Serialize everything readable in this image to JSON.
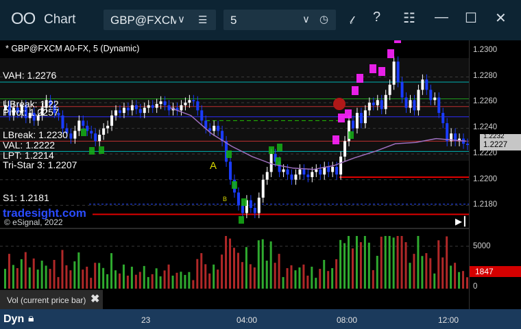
{
  "window": {
    "app_icon": "OO",
    "title": "Chart",
    "symbol": "GBP@FXCM",
    "interval": "5",
    "icons": {
      "symbol_dropdown": "chevron-down-icon",
      "symbol_list": "list-icon",
      "interval_dropdown": "chevron-down-icon",
      "interval_clock": "clock-icon",
      "draw": "pen-icon",
      "help": "help-icon",
      "template": "template-icon",
      "minimize": "minimize-icon",
      "maximize": "maximize-icon",
      "close": "close-icon"
    }
  },
  "chart": {
    "study_title": "* GBP@FXCM A0-FX, 5 (Dynamic)",
    "levels": [
      {
        "label": "VAH: 1.2276",
        "color": "#00c8c8"
      },
      {
        "label": "UBreak: 1.22",
        "color": "#22c400"
      },
      {
        "label": "Pivot: 1.2257",
        "color": "#d83a3a"
      },
      {
        "label": "LBreak: 1.2230",
        "color": "#d83a3a"
      },
      {
        "label": "VAL: 1.2222",
        "color": "#00c8c8"
      },
      {
        "label": "LPT: 1.2214",
        "color": "#ffffff"
      },
      {
        "label": "Tri-Star 3: 1.2207",
        "color": "#ffffff"
      },
      {
        "label": "S1: 1.2181",
        "color": "#2a4cff"
      }
    ],
    "brand": "tradesight.com",
    "copyright": "© eSignal, 2022",
    "marker_A": "A",
    "marker_B": "B",
    "last_price": "1.2227",
    "last_price_prev": "1.2232",
    "y_ticks": [
      "1.2300",
      "1.2280",
      "1.2260",
      "1.2240",
      "1.2220",
      "1.2200",
      "1.2180"
    ],
    "colors": {
      "bull": "#ffffff",
      "bear": "#1a3cff",
      "ma": "#a070c0",
      "magenta": "#ff22ff",
      "green_counter": "#16b016",
      "red_line": "#e00000"
    }
  },
  "volume": {
    "legend": "Vol (current price bar)",
    "close_icon": "close-icon",
    "close_glyph": "✖",
    "y_ticks": [
      "5000",
      "0"
    ],
    "current": "1847"
  },
  "bottom": {
    "mode": "Dyn",
    "lock_icon": "lock-icon",
    "x_ticks": [
      "23",
      "04:00",
      "08:00",
      "12:00"
    ]
  },
  "chart_data": {
    "type": "candlestick",
    "symbol": "GBP@FXCM A0-FX",
    "interval": "5",
    "ylim": [
      1.2165,
      1.2305
    ],
    "x_ticks": [
      "23",
      "04:00",
      "08:00",
      "12:00"
    ],
    "path": [
      [
        0,
        1.2254
      ],
      [
        6,
        1.2258
      ],
      [
        12,
        1.225
      ],
      [
        18,
        1.2256
      ],
      [
        24,
        1.2252
      ],
      [
        30,
        1.2258
      ],
      [
        36,
        1.2248
      ],
      [
        42,
        1.2252
      ],
      [
        48,
        1.2246
      ],
      [
        54,
        1.225
      ],
      [
        60,
        1.2256
      ],
      [
        66,
        1.2262
      ],
      [
        72,
        1.2258
      ],
      [
        78,
        1.2252
      ],
      [
        84,
        1.225
      ],
      [
        90,
        1.224
      ],
      [
        96,
        1.2236
      ],
      [
        102,
        1.2232
      ],
      [
        108,
        1.2238
      ],
      [
        114,
        1.2246
      ],
      [
        120,
        1.2242
      ],
      [
        126,
        1.2238
      ],
      [
        132,
        1.2236
      ],
      [
        138,
        1.223
      ],
      [
        144,
        1.2235
      ],
      [
        150,
        1.224
      ],
      [
        156,
        1.2242
      ],
      [
        162,
        1.225
      ],
      [
        168,
        1.2254
      ],
      [
        174,
        1.2252
      ],
      [
        180,
        1.2256
      ],
      [
        186,
        1.2254
      ],
      [
        192,
        1.2258
      ],
      [
        198,
        1.2255
      ],
      [
        204,
        1.2252
      ],
      [
        210,
        1.2256
      ],
      [
        216,
        1.2258
      ],
      [
        222,
        1.2256
      ],
      [
        228,
        1.2259
      ],
      [
        234,
        1.2261
      ],
      [
        240,
        1.2258
      ],
      [
        246,
        1.2254
      ],
      [
        252,
        1.2256
      ],
      [
        258,
        1.2254
      ],
      [
        264,
        1.2258
      ],
      [
        270,
        1.226
      ],
      [
        276,
        1.2262
      ],
      [
        282,
        1.2261
      ],
      [
        288,
        1.2254
      ],
      [
        294,
        1.2246
      ],
      [
        300,
        1.224
      ],
      [
        306,
        1.2238
      ],
      [
        312,
        1.2242
      ],
      [
        318,
        1.2238
      ],
      [
        324,
        1.223
      ],
      [
        330,
        1.2214
      ],
      [
        336,
        1.22
      ],
      [
        342,
        1.219
      ],
      [
        348,
        1.218
      ],
      [
        354,
        1.2174
      ],
      [
        360,
        1.2184
      ],
      [
        366,
        1.2178
      ],
      [
        372,
        1.2174
      ],
      [
        378,
        1.2186
      ],
      [
        384,
        1.22
      ],
      [
        390,
        1.2206
      ],
      [
        396,
        1.222
      ],
      [
        402,
        1.2214
      ],
      [
        408,
        1.2206
      ],
      [
        414,
        1.2208
      ],
      [
        420,
        1.2204
      ],
      [
        426,
        1.22
      ],
      [
        432,
        1.2204
      ],
      [
        438,
        1.2208
      ],
      [
        444,
        1.2204
      ],
      [
        450,
        1.2202
      ],
      [
        456,
        1.2206
      ],
      [
        462,
        1.2208
      ],
      [
        468,
        1.2204
      ],
      [
        474,
        1.221
      ],
      [
        480,
        1.2206
      ],
      [
        486,
        1.221
      ],
      [
        492,
        1.2204
      ],
      [
        498,
        1.2218
      ],
      [
        504,
        1.223
      ],
      [
        510,
        1.2246
      ],
      [
        516,
        1.224
      ],
      [
        522,
        1.2252
      ],
      [
        528,
        1.2244
      ],
      [
        534,
        1.2254
      ],
      [
        540,
        1.226
      ],
      [
        546,
        1.2258
      ],
      [
        552,
        1.2262
      ],
      [
        558,
        1.2255
      ],
      [
        564,
        1.2266
      ],
      [
        570,
        1.2274
      ],
      [
        576,
        1.2292
      ],
      [
        582,
        1.2276
      ],
      [
        588,
        1.2264
      ],
      [
        594,
        1.2256
      ],
      [
        600,
        1.2262
      ],
      [
        606,
        1.2254
      ],
      [
        612,
        1.227
      ],
      [
        618,
        1.2278
      ],
      [
        624,
        1.227
      ],
      [
        630,
        1.2262
      ],
      [
        636,
        1.2264
      ],
      [
        642,
        1.2252
      ],
      [
        648,
        1.2244
      ],
      [
        654,
        1.223
      ],
      [
        660,
        1.2236
      ],
      [
        666,
        1.223
      ],
      [
        672,
        1.2232
      ],
      [
        678,
        1.2228
      ],
      [
        684,
        1.2227
      ]
    ],
    "moving_average": [
      [
        250,
        1.2256
      ],
      [
        280,
        1.225
      ],
      [
        310,
        1.2236
      ],
      [
        340,
        1.2226
      ],
      [
        370,
        1.2218
      ],
      [
        400,
        1.2212
      ],
      [
        430,
        1.2209
      ],
      [
        460,
        1.2208
      ],
      [
        490,
        1.2211
      ],
      [
        520,
        1.2217
      ],
      [
        550,
        1.2222
      ],
      [
        580,
        1.2228
      ],
      [
        610,
        1.2229
      ],
      [
        640,
        1.2232
      ],
      [
        684,
        1.223
      ]
    ],
    "volume_ylim": [
      0,
      6600
    ]
  }
}
